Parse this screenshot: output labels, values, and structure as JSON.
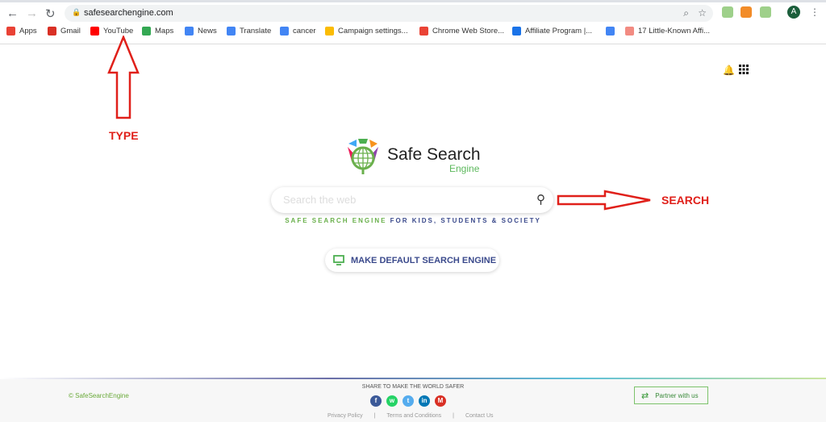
{
  "browser": {
    "url": "safesearchengine.com",
    "profile_initial": "A",
    "bookmarks": [
      {
        "label": "Apps",
        "color": "#e94235"
      },
      {
        "label": "Gmail",
        "color": "#d93025"
      },
      {
        "label": "YouTube",
        "color": "#ff0000"
      },
      {
        "label": "Maps",
        "color": "#34a853"
      },
      {
        "label": "News",
        "color": "#4285f4"
      },
      {
        "label": "Translate",
        "color": "#4285f4"
      },
      {
        "label": "cancer",
        "color": "#4285f4"
      },
      {
        "label": "Campaign settings...",
        "color": "#fbbc04"
      },
      {
        "label": "Chrome Web Store...",
        "color": "#ea4335"
      },
      {
        "label": "Affiliate Program |...",
        "color": "#1a73e8"
      },
      {
        "label": "",
        "color": "#4285f4"
      },
      {
        "label": "17 Little-Known Affi...",
        "color": "#f28b82"
      }
    ]
  },
  "annotations": {
    "type": "TYPE",
    "search": "SEARCH"
  },
  "brand": {
    "name": "Safe Search",
    "sub": "Engine"
  },
  "search": {
    "placeholder": "Search the web"
  },
  "tagline": {
    "green": "SAFE SEARCH ENGINE",
    "blue": "FOR KIDS, STUDENTS & SOCIETY"
  },
  "make_default": "MAKE DEFAULT SEARCH ENGINE",
  "footer": {
    "copyright": "© SafeSearchEngine",
    "share": "SHARE TO MAKE THE WORLD SAFER",
    "links": [
      "Privacy Policy",
      "|",
      "Terms and Conditions",
      "|",
      "Contact Us"
    ],
    "partner": "Partner with us",
    "social": [
      {
        "name": "facebook",
        "glyph": "f",
        "color": "#3b5998"
      },
      {
        "name": "whatsapp",
        "glyph": "w",
        "color": "#25d366"
      },
      {
        "name": "twitter",
        "glyph": "t",
        "color": "#55acee"
      },
      {
        "name": "linkedin",
        "glyph": "in",
        "color": "#0077b5"
      },
      {
        "name": "gmail",
        "glyph": "M",
        "color": "#d93025"
      }
    ]
  }
}
